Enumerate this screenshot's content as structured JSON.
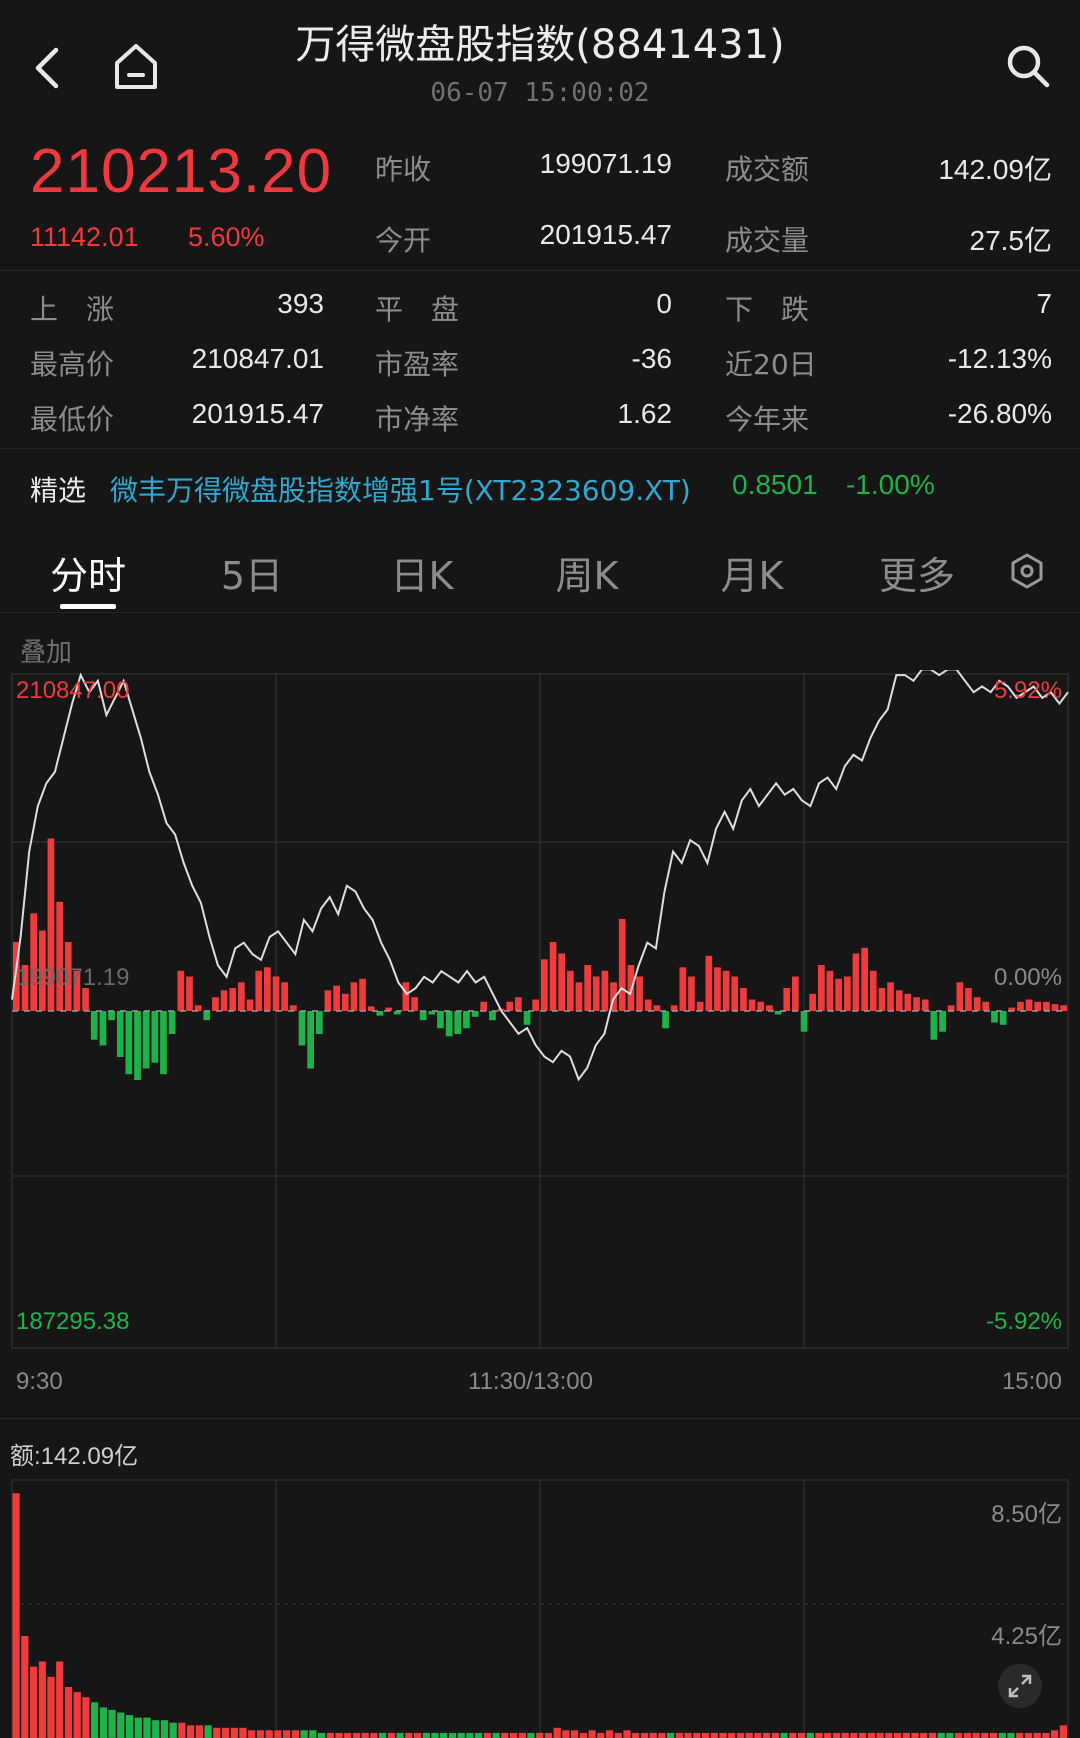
{
  "header": {
    "title": "万得微盘股指数(8841431)",
    "timestamp": "06-07 15:00:02",
    "back_icon": "back-arrow-icon",
    "home_icon": "home-icon",
    "search_icon": "search-icon"
  },
  "quote": {
    "price": "210213.20",
    "change": "11142.01",
    "change_pct": "5.60%",
    "prev_close_label": "昨收",
    "prev_close": "199071.19",
    "open_label": "今开",
    "open": "201915.47",
    "turnover_label": "成交额",
    "turnover": "142.09亿",
    "volume_label": "成交量",
    "volume": "27.5亿"
  },
  "stats": {
    "up_label": "上　涨",
    "up": "393",
    "flat_label": "平　盘",
    "flat": "0",
    "down_label": "下　跌",
    "down": "7",
    "high_label": "最高价",
    "high": "210847.01",
    "pe_label": "市盈率",
    "pe": "-36",
    "d20_label": "近20日",
    "d20": "-12.13%",
    "low_label": "最低价",
    "low": "201915.47",
    "pb_label": "市净率",
    "pb": "1.62",
    "ytd_label": "今年来",
    "ytd": "-26.80%"
  },
  "featured": {
    "label": "精选",
    "fund_name": "微丰万得微盘股指数增强1号(XT2323609.XT)",
    "nav": "0.8501",
    "nav_change": "-1.00%"
  },
  "tabs": [
    "分时",
    "5日",
    "日K",
    "周K",
    "月K",
    "更多"
  ],
  "active_tab": 0,
  "chart": {
    "overlay_label": "叠加",
    "top_left": "210847.00",
    "top_right": "5.92%",
    "mid_left": "199071.19",
    "mid_right": "0.00%",
    "bottom_left": "187295.38",
    "bottom_right": "-5.92%",
    "time_start": "9:30",
    "time_mid": "11:30/13:00",
    "time_end": "15:00",
    "volume_label": "额:142.09亿",
    "vol_top": "8.50亿",
    "vol_mid": "4.25亿"
  },
  "colors": {
    "up": "#ee3b3b",
    "down": "#1fb24a",
    "link": "#2fa7cf",
    "bg": "#161616"
  },
  "chart_data": {
    "type": "line",
    "y_range": [
      187295.38,
      210847.0
    ],
    "pct_range": [
      -5.92,
      5.92
    ],
    "prev_close": 199071.19,
    "time_axis": [
      "9:30",
      "11:30/13:00",
      "15:00"
    ],
    "price_pct": [
      0.2,
      1.3,
      2.8,
      3.6,
      4.0,
      4.2,
      4.8,
      5.4,
      5.9,
      5.6,
      5.8,
      5.2,
      5.5,
      5.8,
      5.3,
      4.8,
      4.2,
      3.8,
      3.3,
      3.1,
      2.6,
      2.2,
      1.9,
      1.3,
      0.8,
      0.6,
      1.1,
      1.2,
      1.0,
      0.9,
      1.3,
      1.4,
      1.2,
      1.0,
      1.6,
      1.4,
      1.8,
      2.0,
      1.7,
      2.2,
      2.1,
      1.8,
      1.6,
      1.2,
      0.9,
      0.5,
      0.3,
      0.4,
      0.6,
      0.5,
      0.7,
      0.6,
      0.5,
      0.7,
      0.5,
      0.6,
      0.3,
      0.0,
      -0.2,
      -0.4,
      -0.3,
      -0.6,
      -0.8,
      -0.9,
      -0.7,
      -0.8,
      -1.2,
      -1.0,
      -0.6,
      -0.4,
      0.2,
      0.4,
      0.3,
      0.8,
      1.2,
      1.1,
      2.1,
      2.8,
      2.6,
      3.0,
      2.9,
      2.6,
      3.2,
      3.5,
      3.2,
      3.7,
      3.9,
      3.6,
      3.8,
      4.0,
      3.8,
      3.9,
      3.7,
      3.6,
      4.0,
      4.1,
      3.9,
      4.3,
      4.5,
      4.4,
      4.8,
      5.1,
      5.3,
      5.9,
      5.9,
      5.8,
      6.0,
      6.0,
      5.9,
      6.0,
      6.0,
      5.8,
      5.6,
      5.7,
      5.6,
      5.8,
      5.7,
      5.5,
      5.6,
      5.7,
      5.5,
      5.6,
      5.4,
      5.6
    ],
    "flow_bars": [
      60,
      40,
      85,
      70,
      150,
      95,
      60,
      35,
      20,
      -25,
      -30,
      -8,
      -40,
      -55,
      -60,
      -50,
      -45,
      -55,
      -20,
      35,
      30,
      5,
      -8,
      12,
      18,
      20,
      25,
      10,
      35,
      38,
      30,
      25,
      5,
      -30,
      -50,
      -20,
      18,
      22,
      15,
      25,
      28,
      4,
      -4,
      3,
      -3,
      25,
      12,
      -8,
      -3,
      -15,
      -22,
      -20,
      -15,
      -5,
      8,
      -8,
      2,
      8,
      12,
      -12,
      10,
      45,
      60,
      50,
      35,
      25,
      40,
      30,
      35,
      25,
      80,
      40,
      30,
      10,
      5,
      -15,
      5,
      38,
      30,
      8,
      48,
      38,
      35,
      30,
      20,
      10,
      8,
      5,
      -3,
      20,
      30,
      -18,
      15,
      40,
      35,
      28,
      30,
      50,
      55,
      35,
      20,
      25,
      18,
      15,
      12,
      10,
      -25,
      -18,
      5,
      25,
      20,
      12,
      8,
      -10,
      -12,
      3,
      8,
      10,
      8,
      8,
      6,
      5
    ],
    "volume_bars": [
      96,
      40,
      28,
      30,
      24,
      30,
      20,
      18,
      16,
      14,
      12,
      11,
      10,
      9,
      8,
      8,
      7,
      7,
      6,
      6,
      5,
      5,
      5,
      4,
      4,
      4,
      4,
      3,
      3,
      3,
      3,
      3,
      3,
      3,
      3,
      2,
      2,
      2,
      2,
      2,
      2,
      2,
      2,
      2,
      2,
      2,
      2,
      2,
      2,
      2,
      2,
      2,
      2,
      2,
      2,
      2,
      2,
      2,
      2,
      2,
      2,
      2,
      4,
      3,
      3,
      2,
      3,
      2,
      3,
      2,
      3,
      2,
      2,
      2,
      2,
      2,
      2,
      2,
      2,
      2,
      2,
      2,
      2,
      2,
      2,
      2,
      2,
      2,
      2,
      2,
      2,
      2,
      2,
      2,
      2,
      2,
      2,
      2,
      2,
      2,
      2,
      2,
      2,
      2,
      2,
      2,
      2,
      2,
      2,
      2,
      2,
      2,
      2,
      2,
      2,
      2,
      2,
      2,
      2,
      3,
      5
    ]
  }
}
